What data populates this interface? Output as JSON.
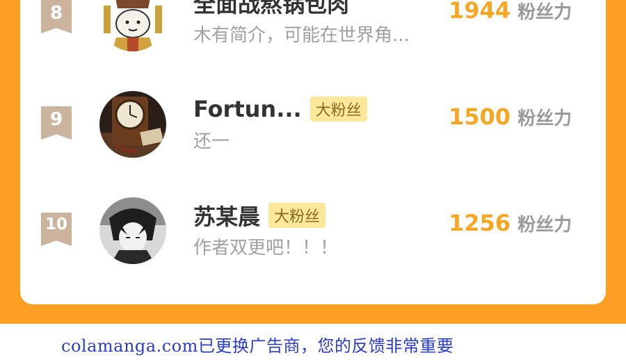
{
  "leaderboard": {
    "rows": [
      {
        "rank": "8",
        "name": "全面战熬锅包肉",
        "badge": "",
        "description": "木有简介，可能在世界角...",
        "score": "1944",
        "score_unit": "粉丝力",
        "avatar": "cartoon-character-avatar"
      },
      {
        "rank": "9",
        "name": "Fortun...",
        "badge": "大粉丝",
        "description": "还一",
        "score": "1500",
        "score_unit": "粉丝力",
        "avatar": "clock-photo-avatar"
      },
      {
        "rank": "10",
        "name": "苏某晨",
        "badge": "大粉丝",
        "description": "作者双更吧！！！",
        "score": "1256",
        "score_unit": "粉丝力",
        "avatar": "anime-character-avatar"
      }
    ]
  },
  "footer": {
    "notice": "colamanga.com已更换广告商，您的反馈非常重要"
  },
  "colors": {
    "frame": "#fc9f22",
    "score": "#f5a623",
    "badge_bg": "#fde79a",
    "rank_badge": "#cbb49e",
    "footer_link": "#2a3cc9"
  }
}
